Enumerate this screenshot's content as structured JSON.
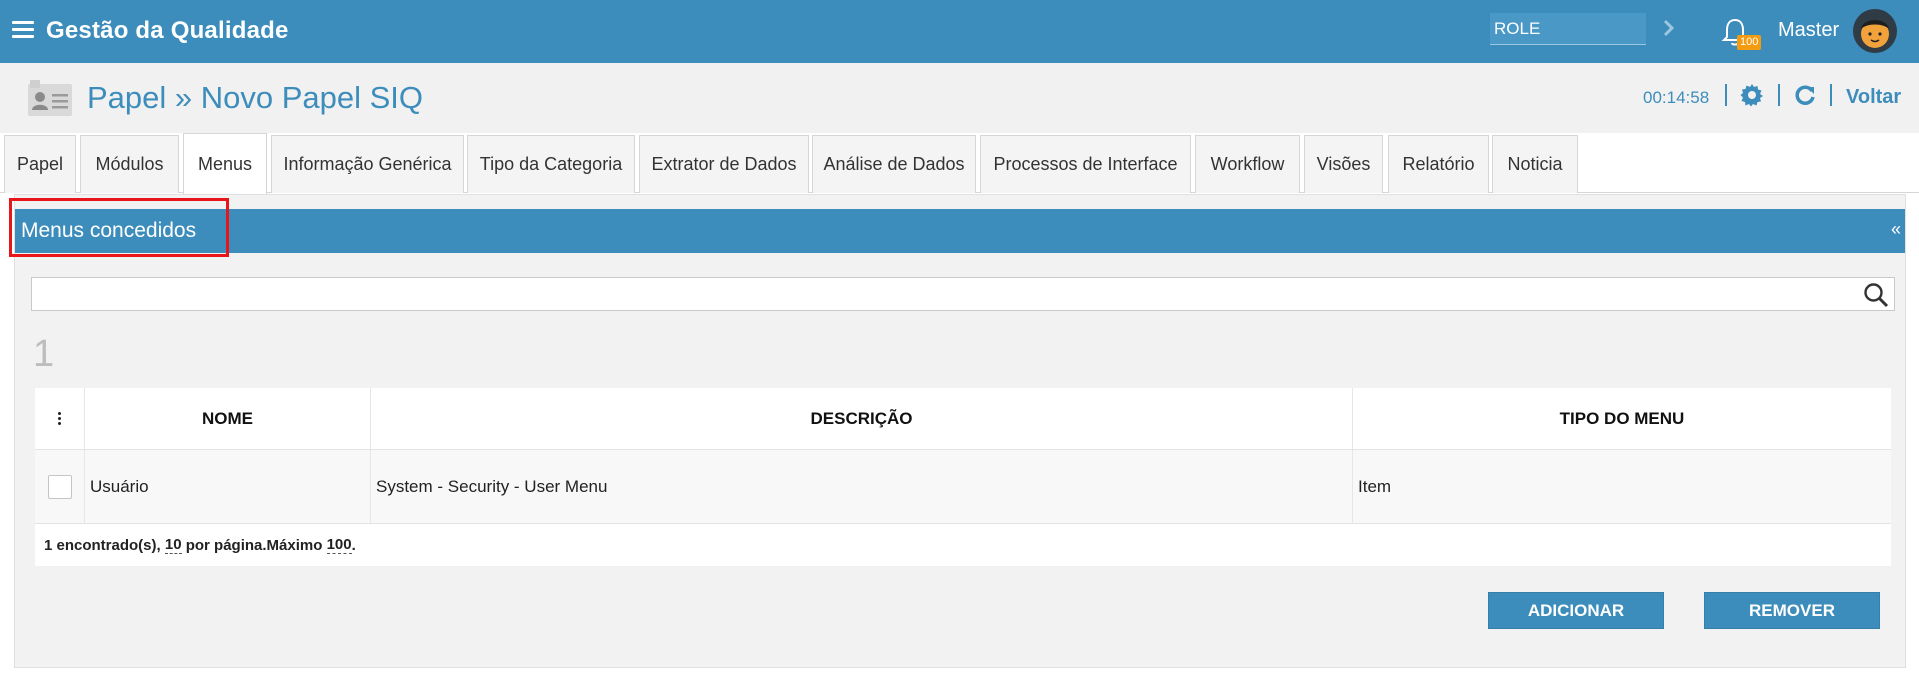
{
  "app": {
    "title": "Gestão da Qualidade"
  },
  "topbar": {
    "role_value": "ROLE",
    "notification_count": "100",
    "user_name": "Master"
  },
  "header": {
    "title": "Papel » Novo Papel SIQ",
    "timer": "00:14:58",
    "back_label": "Voltar"
  },
  "tabs": [
    {
      "label": "Papel"
    },
    {
      "label": "Módulos"
    },
    {
      "label": "Menus",
      "active": true
    },
    {
      "label": "Informação Genérica"
    },
    {
      "label": "Tipo da Categoria"
    },
    {
      "label": "Extrator de Dados"
    },
    {
      "label": "Análise de Dados"
    },
    {
      "label": "Processos de Interface"
    },
    {
      "label": "Workflow"
    },
    {
      "label": "Visões"
    },
    {
      "label": "Relatório"
    },
    {
      "label": "Noticia"
    }
  ],
  "panel": {
    "title": "Menus concedidos",
    "collapse_glyph": "«",
    "search_value": "",
    "page_number": "1"
  },
  "table": {
    "columns": [
      "NOME",
      "DESCRIÇÃO",
      "TIPO DO MENU"
    ],
    "rows": [
      {
        "nome": "Usuário",
        "descricao": "System - Security - User Menu",
        "tipo": "Item"
      }
    ],
    "footer": {
      "found": "1 encontrado(s),",
      "per_page_value": "10",
      "per_page_text": "por página.Máximo",
      "max_value": "100",
      "end": "."
    }
  },
  "actions": {
    "add_label": "ADICIONAR",
    "remove_label": "REMOVER"
  },
  "colors": {
    "primary": "#3c8dbc",
    "badge": "#f39c12",
    "highlight": "#e8161b"
  },
  "icons": [
    "menu-icon",
    "chevron-right-icon",
    "bell-icon",
    "avatar",
    "id-card-icon",
    "gear-icon",
    "refresh-icon",
    "search-icon",
    "kebab-icon"
  ]
}
